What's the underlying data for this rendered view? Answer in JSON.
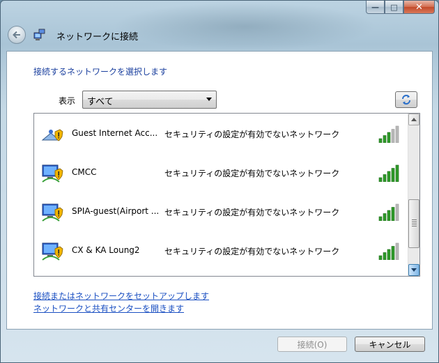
{
  "window": {
    "title": "ネットワークに接続",
    "caption": {
      "minimize": "—",
      "maximize": "□",
      "close": "✕"
    }
  },
  "main": {
    "instruction": "接続するネットワークを選択します",
    "show_label": "表示",
    "filter": {
      "selected": "すべて"
    },
    "networks": [
      {
        "name": "Guest Internet Acc...",
        "security": "セキュリティの設定が有効でないネットワーク",
        "signal_bars": 3,
        "icon": "wireless-network-shield-icon"
      },
      {
        "name": "CMCC",
        "security": "セキュリティの設定が有効でないネットワーク",
        "signal_bars": 5,
        "icon": "wireless-network-shield-icon"
      },
      {
        "name": "SPIA-guest(Airport ...",
        "security": "セキュリティの設定が有効でないネットワーク",
        "signal_bars": 4,
        "icon": "wireless-network-shield-icon"
      },
      {
        "name": "CX & KA Loung2",
        "security": "セキュリティの設定が有効でないネットワーク",
        "signal_bars": 4,
        "icon": "wireless-network-shield-icon"
      }
    ],
    "links": {
      "setup": "接続またはネットワークをセットアップします",
      "sharing_center": "ネットワークと共有センターを開きます"
    }
  },
  "footer": {
    "connect": "接続(O)",
    "cancel": "キャンセル"
  },
  "colors": {
    "link": "#1a4fc2",
    "instruction": "#1a3f9e",
    "signal_on": "#2f9a2a",
    "signal_off": "#b8b8b8"
  }
}
